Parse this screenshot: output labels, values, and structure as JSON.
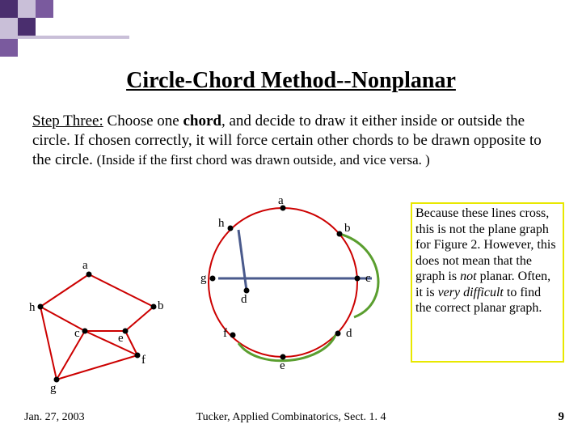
{
  "title": "Circle-Chord Method--Nonplanar",
  "step": {
    "label": "Step Three:",
    "text1": " Choose one ",
    "bold": "chord",
    "text2": ", and decide to draw it either inside or outside the circle. If chosen correctly, it will force certain other chords to be drawn opposite to the circle. ",
    "paren": "(Inside if the first chord was drawn outside, and vice versa. )"
  },
  "note": {
    "l1": "Because these lines cross, this is not the plane graph for Figure 2.  However, this does not mean that the graph is ",
    "i1": "not",
    "l2": " planar. Often, it is ",
    "i2": "very difficult",
    "l3": " to find the correct planar graph."
  },
  "vertex_labels": {
    "a": "a",
    "b": "b",
    "c": "c",
    "d": "d",
    "e": "e",
    "f": "f",
    "g": "g",
    "h": "h"
  },
  "footer": {
    "date": "Jan. 27, 2003",
    "cite": "Tucker, Applied Combinatorics, Sect. 1. 4",
    "page": "9"
  }
}
